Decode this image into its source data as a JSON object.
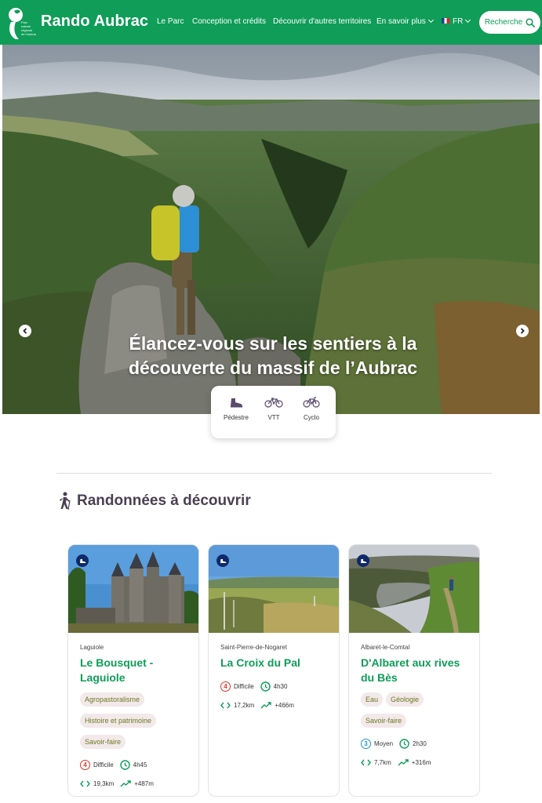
{
  "header": {
    "brand": "Rando Aubrac",
    "logo_text": "Parc naturel régional de l'Aubrac",
    "nav": [
      {
        "label": "Le Parc",
        "dropdown": false
      },
      {
        "label": "Conception et crédits",
        "dropdown": false
      },
      {
        "label": "Découvrir d'autres territoires",
        "dropdown": false
      },
      {
        "label": "En savoir plus",
        "dropdown": true
      }
    ],
    "language": "FR",
    "search_label": "Recherche"
  },
  "hero": {
    "title": "Élancez-vous sur les sentiers à la découverte du massif de l’Aubrac"
  },
  "activities": [
    {
      "label": "Pédestre",
      "icon": "hiking-boot-icon"
    },
    {
      "label": "VTT",
      "icon": "mountain-bike-icon"
    },
    {
      "label": "Cyclo",
      "icon": "road-bike-icon"
    }
  ],
  "section": {
    "title": "Randonnées à découvrir",
    "icon": "hiker-icon"
  },
  "cards": [
    {
      "location": "Laguiole",
      "title": "Le Bousquet - Laguiole",
      "tags": [
        "Agropastoralisme",
        "Histoire et patrimoine",
        "Savoir-faire"
      ],
      "difficulty_level": "4",
      "difficulty": "Difficile",
      "duration": "4h45",
      "distance": "19,3km",
      "elevation": "+487m"
    },
    {
      "location": "Saint-Pierre-de-Nogaret",
      "title": "La Croix du Pal",
      "tags": [],
      "difficulty_level": "4",
      "difficulty": "Difficile",
      "duration": "4h30",
      "distance": "17,2km",
      "elevation": "+466m"
    },
    {
      "location": "Albaret-le-Comtal",
      "title": "D'Albaret aux rives du Bès",
      "tags": [
        "Eau",
        "Géologie",
        "Savoir-faire"
      ],
      "difficulty_level": "3",
      "difficulty": "Moyen",
      "duration": "2h30",
      "distance": "7,7km",
      "elevation": "+316m"
    }
  ],
  "colors": {
    "brand_green": "#0f9d58",
    "title_purple": "#4a4052",
    "difficult_red": "#e0352b",
    "medium_blue": "#1d95d3",
    "badge_navy": "#0e2a6b",
    "tag_bg": "#f3e8ea",
    "tag_text": "#6a7a1e"
  }
}
